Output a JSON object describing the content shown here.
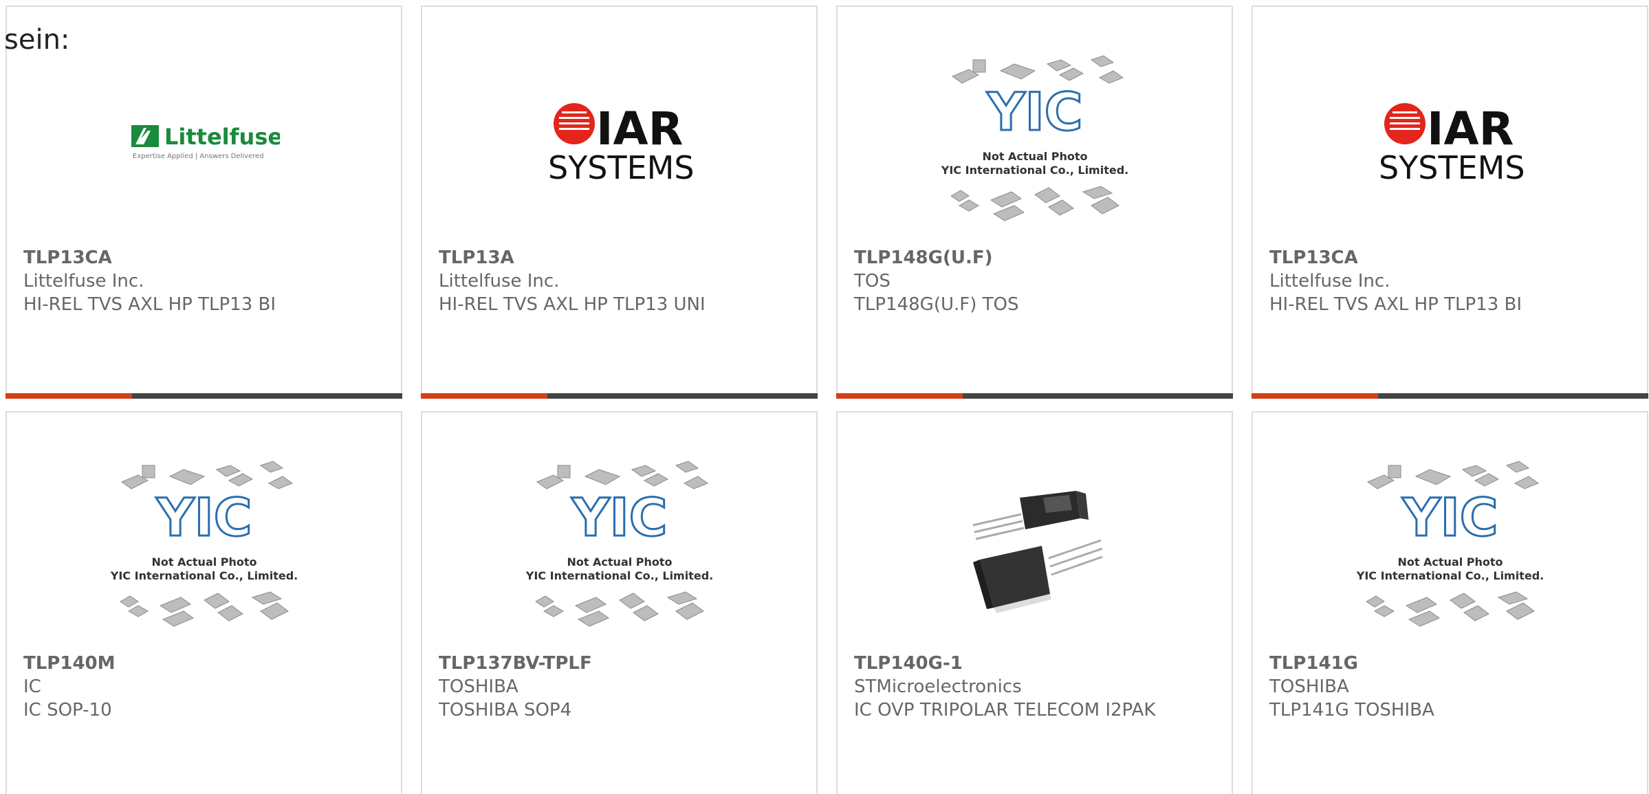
{
  "intro_text": "sein:",
  "colors": {
    "accent": "#d43f1a",
    "bar": "#444444",
    "border": "#dddddd",
    "text": "#666666",
    "littelfuse_green": "#1a8a3c",
    "iar_red": "#e3251b"
  },
  "logo_text": {
    "littelfuse_name": "Littelfuse",
    "littelfuse_tagline": "Expertise Applied | Answers Delivered",
    "iar_name": "IAR",
    "iar_sub": "SYSTEMS",
    "yic_mark": "YIC",
    "yic_note_1": "Not Actual Photo",
    "yic_note_2": "YIC International Co., Limited."
  },
  "products": [
    {
      "part": "TLP13CA",
      "maker": "Littelfuse Inc.",
      "desc": "HI-REL TVS AXL HP TLP13 BI",
      "image": "littelfuse-logo"
    },
    {
      "part": "TLP13A",
      "maker": "Littelfuse Inc.",
      "desc": "HI-REL TVS AXL HP TLP13 UNI",
      "image": "iar-systems-logo"
    },
    {
      "part": "TLP148G(U.F)",
      "maker": "TOS",
      "desc": "TLP148G(U.F) TOS",
      "image": "yic-placeholder"
    },
    {
      "part": "TLP13CA",
      "maker": "Littelfuse Inc.",
      "desc": "HI-REL TVS AXL HP TLP13 BI",
      "image": "iar-systems-logo"
    },
    {
      "part": "TLP140M",
      "maker": "IC",
      "desc": "IC SOP-10",
      "image": "yic-placeholder"
    },
    {
      "part": "TLP137BV-TPLF",
      "maker": "TOSHIBA",
      "desc": "TOSHIBA SOP4",
      "image": "yic-placeholder"
    },
    {
      "part": "TLP140G-1",
      "maker": "STMicroelectronics",
      "desc": "IC OVP TRIPOLAR TELECOM I2PAK",
      "image": "i2pak-photo"
    },
    {
      "part": "TLP141G",
      "maker": "TOSHIBA",
      "desc": "TLP141G TOSHIBA",
      "image": "yic-placeholder"
    }
  ]
}
